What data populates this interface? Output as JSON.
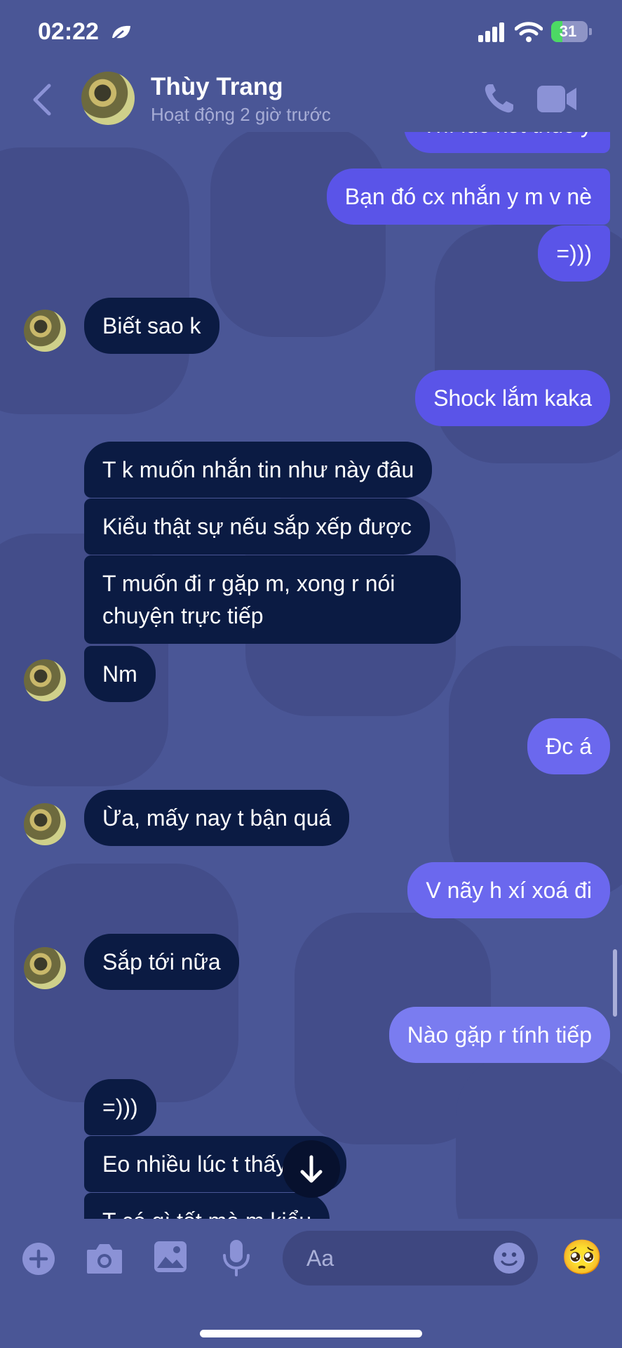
{
  "status_bar": {
    "time": "02:22",
    "battery": "31"
  },
  "header": {
    "name": "Thùy Trang",
    "status": "Hoạt động 2 giờ trước"
  },
  "messages": [
    {
      "from": "me",
      "text": "Thì lúc kết thúc ý"
    },
    {
      "from": "me",
      "text": "Bạn đó cx nhắn y m v nè"
    },
    {
      "from": "me",
      "text": "=)))"
    },
    {
      "from": "them",
      "text": "Biết sao k"
    },
    {
      "from": "me",
      "text": "Shock lắm kaka"
    },
    {
      "from": "them",
      "text": "T k muốn nhắn tin như này đâu"
    },
    {
      "from": "them",
      "text": "Kiểu thật sự nếu sắp xếp được"
    },
    {
      "from": "them",
      "text": "T muốn đi r gặp m, xong r nói"
    },
    {
      "from": "them",
      "text": "chuyện trực tiếp"
    },
    {
      "from": "them",
      "text": "Nm"
    },
    {
      "from": "me",
      "text": "Đc á"
    },
    {
      "from": "them",
      "text": "Ừa, mấy nay t bận quá"
    },
    {
      "from": "me",
      "text": "V nãy h xí xoá đi"
    },
    {
      "from": "them",
      "text": "Sắp tới nữa"
    },
    {
      "from": "me",
      "text": "Nào gặp r tính tiếp"
    },
    {
      "from": "them",
      "text": "=)))"
    },
    {
      "from": "them",
      "text": "Eo nhiều lúc t thấy sắc"
    },
    {
      "from": "them",
      "text": "T có gì tốt mà m kiểu"
    }
  ],
  "composer": {
    "placeholder": "Aa",
    "emoji": "🥺"
  },
  "colors": {
    "background": "#4a5696",
    "incoming": "#0b1b43",
    "outgoing": "#5a54e8"
  },
  "icons": [
    "back-icon",
    "phone-icon",
    "video-icon",
    "plus-icon",
    "camera-icon",
    "gallery-icon",
    "mic-icon",
    "smile-icon",
    "arrow-down-icon"
  ]
}
